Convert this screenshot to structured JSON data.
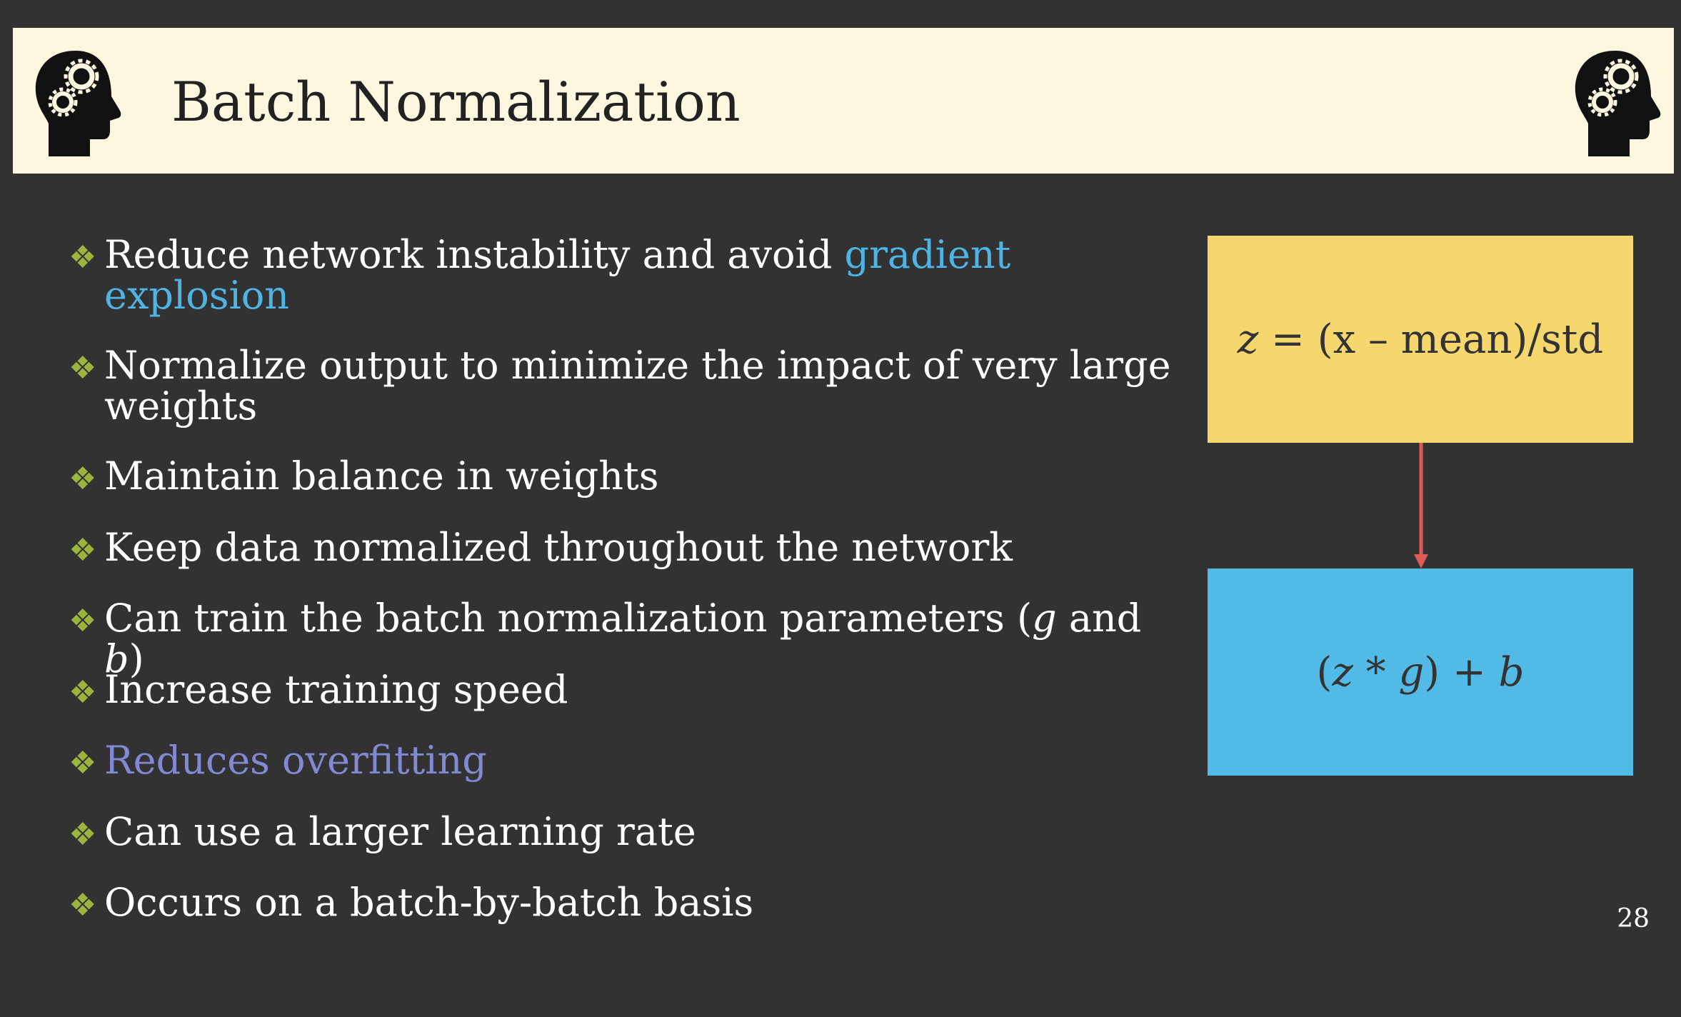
{
  "slide": {
    "title": "Batch Normalization",
    "page_number": "28"
  },
  "icons": {
    "left": "head-with-gears-icon",
    "right": "head-with-gears-icon",
    "bullet": "diamond-bullet-icon"
  },
  "bullet_symbol": "❖",
  "bullets": [
    {
      "text": "Reduce network instability and avoid ",
      "highlight": "gradient explosion"
    },
    {
      "text": "Normalize output to minimize the impact of very large weights"
    },
    {
      "text": "Maintain balance in weights"
    },
    {
      "text": "Keep data normalized throughout the network"
    },
    {
      "pre": "Can train the batch normalization parameters (",
      "var1": "g",
      "mid": " and ",
      "var2": "b",
      "post": ")"
    },
    {
      "text": "Increase training speed"
    },
    {
      "text": "Reduces overfitting"
    },
    {
      "text": "Can use a larger learning rate"
    },
    {
      "text": "Occurs on a batch-by-batch basis"
    }
  ],
  "diagram": {
    "box1": {
      "var": "z",
      "rest": " = (x – mean)/std"
    },
    "box2": {
      "open": "(",
      "z": "z",
      "star": " * ",
      "g": "g",
      "close": ") + ",
      "b": "b"
    }
  },
  "colors": {
    "background": "#323232",
    "title_bar": "#fef7e0",
    "bullet_symbol": "#9bb53c",
    "highlight_blue": "#4fb4e3",
    "highlight_purple": "#8289d3",
    "box_yellow": "#f5d76e",
    "box_blue": "#52bae6",
    "arrow": "#e05a5a"
  }
}
